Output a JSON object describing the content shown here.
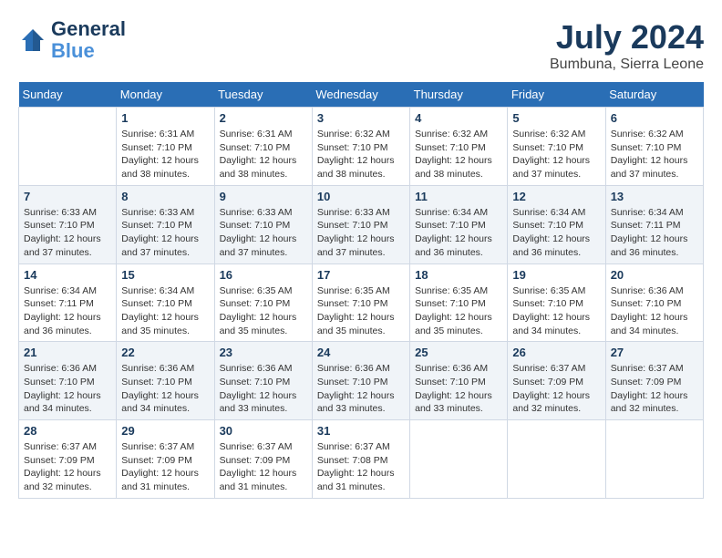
{
  "header": {
    "logo_line1": "General",
    "logo_line2": "Blue",
    "month_year": "July 2024",
    "location": "Bumbuna, Sierra Leone"
  },
  "weekdays": [
    "Sunday",
    "Monday",
    "Tuesday",
    "Wednesday",
    "Thursday",
    "Friday",
    "Saturday"
  ],
  "weeks": [
    [
      {
        "day": "",
        "info": ""
      },
      {
        "day": "1",
        "info": "Sunrise: 6:31 AM\nSunset: 7:10 PM\nDaylight: 12 hours\nand 38 minutes."
      },
      {
        "day": "2",
        "info": "Sunrise: 6:31 AM\nSunset: 7:10 PM\nDaylight: 12 hours\nand 38 minutes."
      },
      {
        "day": "3",
        "info": "Sunrise: 6:32 AM\nSunset: 7:10 PM\nDaylight: 12 hours\nand 38 minutes."
      },
      {
        "day": "4",
        "info": "Sunrise: 6:32 AM\nSunset: 7:10 PM\nDaylight: 12 hours\nand 38 minutes."
      },
      {
        "day": "5",
        "info": "Sunrise: 6:32 AM\nSunset: 7:10 PM\nDaylight: 12 hours\nand 37 minutes."
      },
      {
        "day": "6",
        "info": "Sunrise: 6:32 AM\nSunset: 7:10 PM\nDaylight: 12 hours\nand 37 minutes."
      }
    ],
    [
      {
        "day": "7",
        "info": "Sunrise: 6:33 AM\nSunset: 7:10 PM\nDaylight: 12 hours\nand 37 minutes."
      },
      {
        "day": "8",
        "info": "Sunrise: 6:33 AM\nSunset: 7:10 PM\nDaylight: 12 hours\nand 37 minutes."
      },
      {
        "day": "9",
        "info": "Sunrise: 6:33 AM\nSunset: 7:10 PM\nDaylight: 12 hours\nand 37 minutes."
      },
      {
        "day": "10",
        "info": "Sunrise: 6:33 AM\nSunset: 7:10 PM\nDaylight: 12 hours\nand 37 minutes."
      },
      {
        "day": "11",
        "info": "Sunrise: 6:34 AM\nSunset: 7:10 PM\nDaylight: 12 hours\nand 36 minutes."
      },
      {
        "day": "12",
        "info": "Sunrise: 6:34 AM\nSunset: 7:10 PM\nDaylight: 12 hours\nand 36 minutes."
      },
      {
        "day": "13",
        "info": "Sunrise: 6:34 AM\nSunset: 7:11 PM\nDaylight: 12 hours\nand 36 minutes."
      }
    ],
    [
      {
        "day": "14",
        "info": "Sunrise: 6:34 AM\nSunset: 7:11 PM\nDaylight: 12 hours\nand 36 minutes."
      },
      {
        "day": "15",
        "info": "Sunrise: 6:34 AM\nSunset: 7:10 PM\nDaylight: 12 hours\nand 35 minutes."
      },
      {
        "day": "16",
        "info": "Sunrise: 6:35 AM\nSunset: 7:10 PM\nDaylight: 12 hours\nand 35 minutes."
      },
      {
        "day": "17",
        "info": "Sunrise: 6:35 AM\nSunset: 7:10 PM\nDaylight: 12 hours\nand 35 minutes."
      },
      {
        "day": "18",
        "info": "Sunrise: 6:35 AM\nSunset: 7:10 PM\nDaylight: 12 hours\nand 35 minutes."
      },
      {
        "day": "19",
        "info": "Sunrise: 6:35 AM\nSunset: 7:10 PM\nDaylight: 12 hours\nand 34 minutes."
      },
      {
        "day": "20",
        "info": "Sunrise: 6:36 AM\nSunset: 7:10 PM\nDaylight: 12 hours\nand 34 minutes."
      }
    ],
    [
      {
        "day": "21",
        "info": "Sunrise: 6:36 AM\nSunset: 7:10 PM\nDaylight: 12 hours\nand 34 minutes."
      },
      {
        "day": "22",
        "info": "Sunrise: 6:36 AM\nSunset: 7:10 PM\nDaylight: 12 hours\nand 34 minutes."
      },
      {
        "day": "23",
        "info": "Sunrise: 6:36 AM\nSunset: 7:10 PM\nDaylight: 12 hours\nand 33 minutes."
      },
      {
        "day": "24",
        "info": "Sunrise: 6:36 AM\nSunset: 7:10 PM\nDaylight: 12 hours\nand 33 minutes."
      },
      {
        "day": "25",
        "info": "Sunrise: 6:36 AM\nSunset: 7:10 PM\nDaylight: 12 hours\nand 33 minutes."
      },
      {
        "day": "26",
        "info": "Sunrise: 6:37 AM\nSunset: 7:09 PM\nDaylight: 12 hours\nand 32 minutes."
      },
      {
        "day": "27",
        "info": "Sunrise: 6:37 AM\nSunset: 7:09 PM\nDaylight: 12 hours\nand 32 minutes."
      }
    ],
    [
      {
        "day": "28",
        "info": "Sunrise: 6:37 AM\nSunset: 7:09 PM\nDaylight: 12 hours\nand 32 minutes."
      },
      {
        "day": "29",
        "info": "Sunrise: 6:37 AM\nSunset: 7:09 PM\nDaylight: 12 hours\nand 31 minutes."
      },
      {
        "day": "30",
        "info": "Sunrise: 6:37 AM\nSunset: 7:09 PM\nDaylight: 12 hours\nand 31 minutes."
      },
      {
        "day": "31",
        "info": "Sunrise: 6:37 AM\nSunset: 7:08 PM\nDaylight: 12 hours\nand 31 minutes."
      },
      {
        "day": "",
        "info": ""
      },
      {
        "day": "",
        "info": ""
      },
      {
        "day": "",
        "info": ""
      }
    ]
  ]
}
